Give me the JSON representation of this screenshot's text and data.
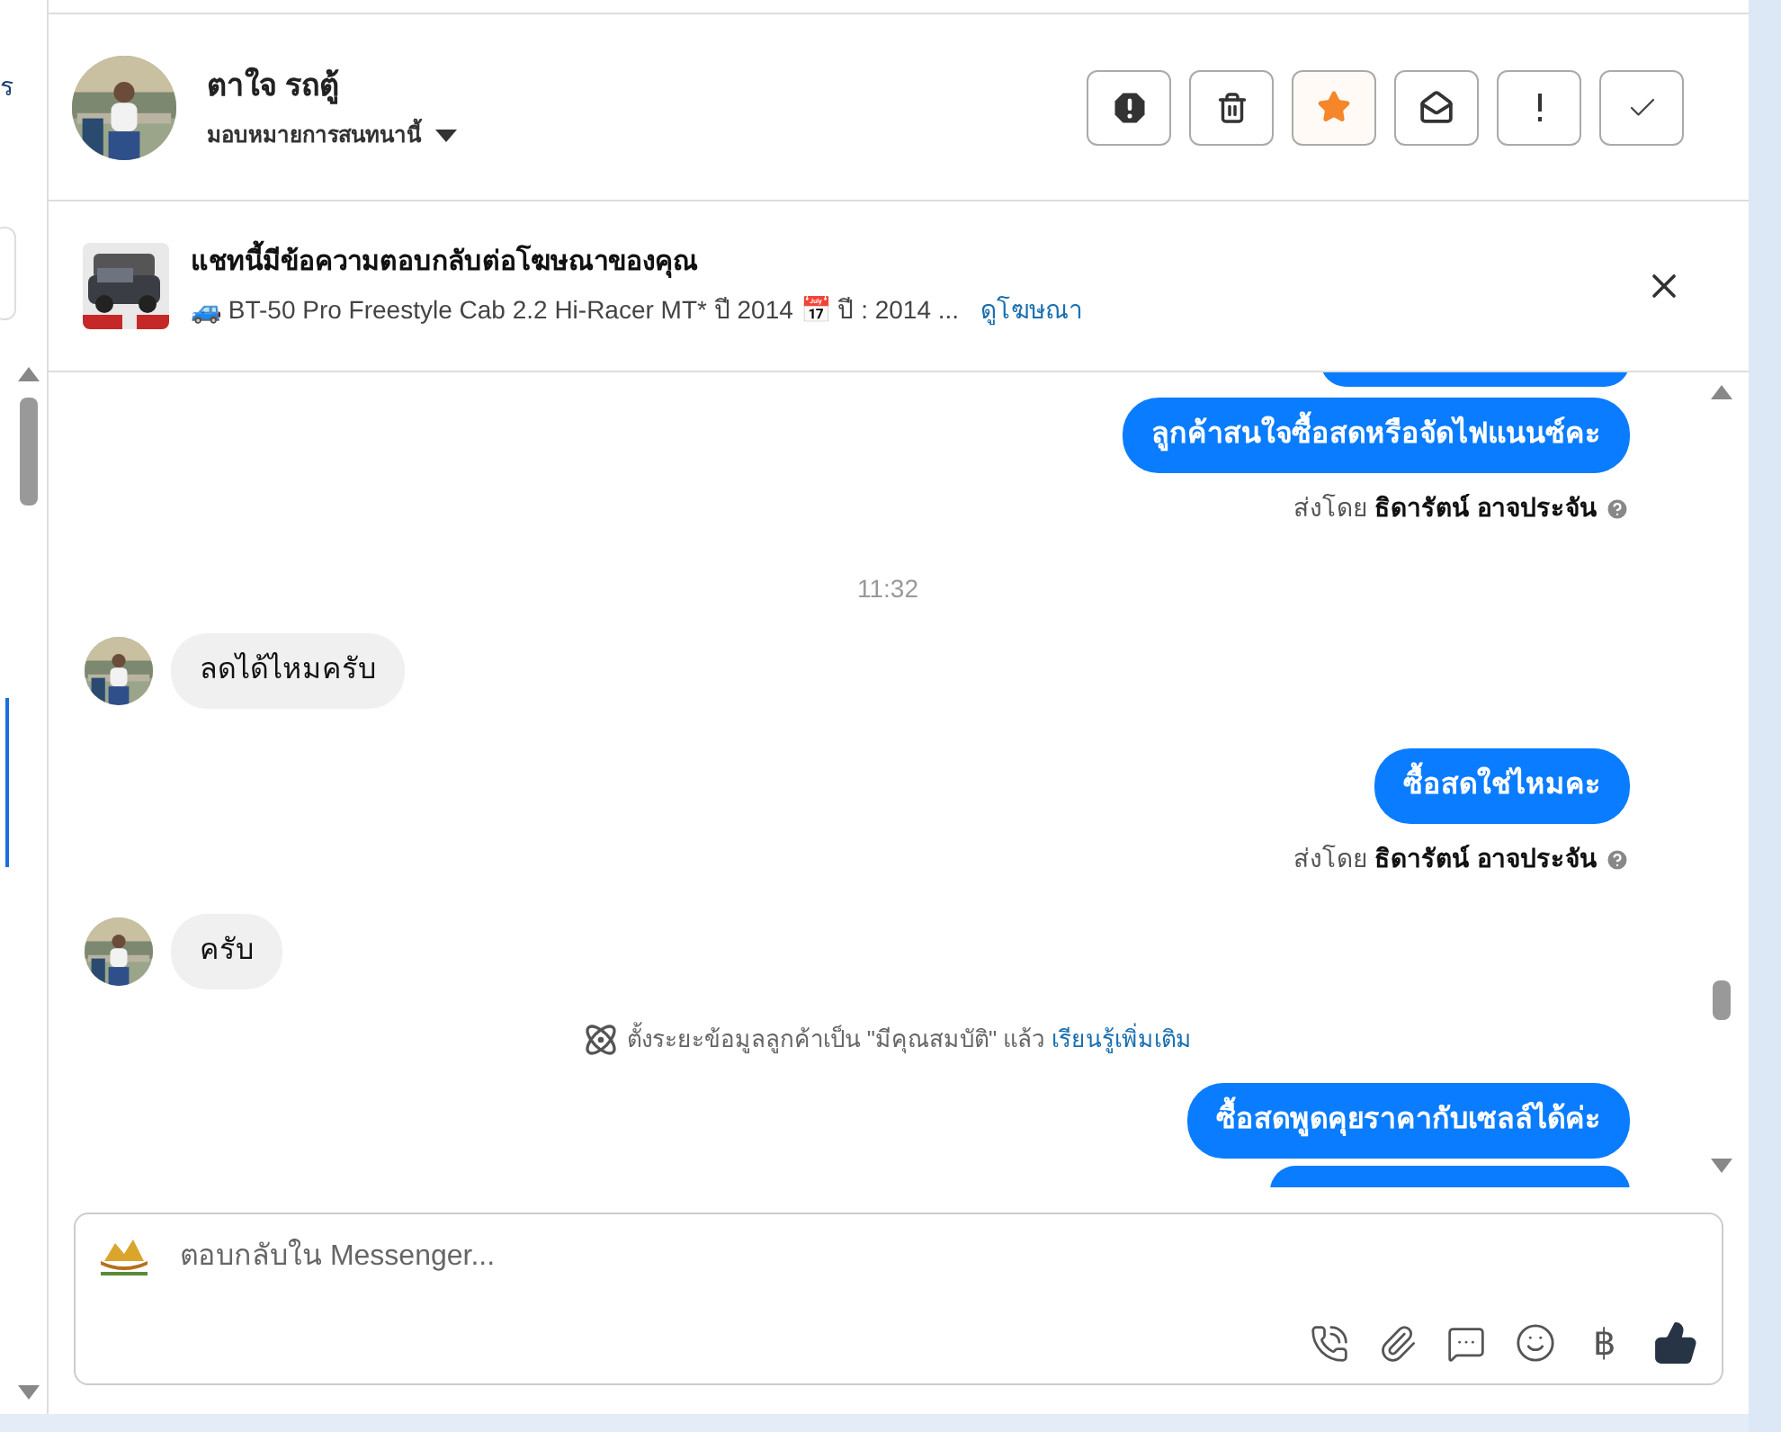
{
  "left_edge": {
    "fragments": [
      "ร"
    ]
  },
  "header": {
    "name": "ตาใจ รถตู้",
    "assign": "มอบหมายการสนทนานี้",
    "actions": [
      {
        "kind": "spam",
        "active": false
      },
      {
        "kind": "trash",
        "active": false
      },
      {
        "kind": "star",
        "active": true
      },
      {
        "kind": "unread",
        "active": false
      },
      {
        "kind": "important",
        "active": false
      },
      {
        "kind": "done",
        "active": false
      }
    ]
  },
  "ad_banner": {
    "title": "แชทนี้มีข้อความตอบกลับต่อโฆษณาของคุณ",
    "summary": "🚙 BT-50 Pro Freestyle Cab 2.2 Hi-Racer MT* ปี 2014 📅 ปี : 2014 ...",
    "link": "ดูโฆษณา"
  },
  "messages": [
    {
      "kind": "outgoing",
      "text": "ลูกค้าสนใจซื้อสดหรือจัดไฟแนนซ์คะ"
    },
    {
      "kind": "sent_by",
      "prefix": "ส่งโดย",
      "name": "ธิดารัตน์ อาจประจัน"
    },
    {
      "kind": "time",
      "text": "11:32"
    },
    {
      "kind": "incoming",
      "text": "ลดได้ไหมครับ"
    },
    {
      "kind": "outgoing",
      "text": "ซื้อสดใช่ไหมคะ"
    },
    {
      "kind": "sent_by",
      "prefix": "ส่งโดย",
      "name": "ธิดารัตน์ อาจประจัน"
    },
    {
      "kind": "incoming",
      "text": "ครับ"
    },
    {
      "kind": "system",
      "text": "ตั้งระยะข้อมูลลูกค้าเป็น \"มีคุณสมบัติ\" แล้ว",
      "link": "เรียนรู้เพิ่มเติม"
    },
    {
      "kind": "outgoing",
      "text": "ซื้อสดพูดคุยราคากับเซลล์ได้ค่ะ"
    }
  ],
  "composer": {
    "placeholder": "ตอบกลับใน Messenger...",
    "currency": "฿"
  }
}
